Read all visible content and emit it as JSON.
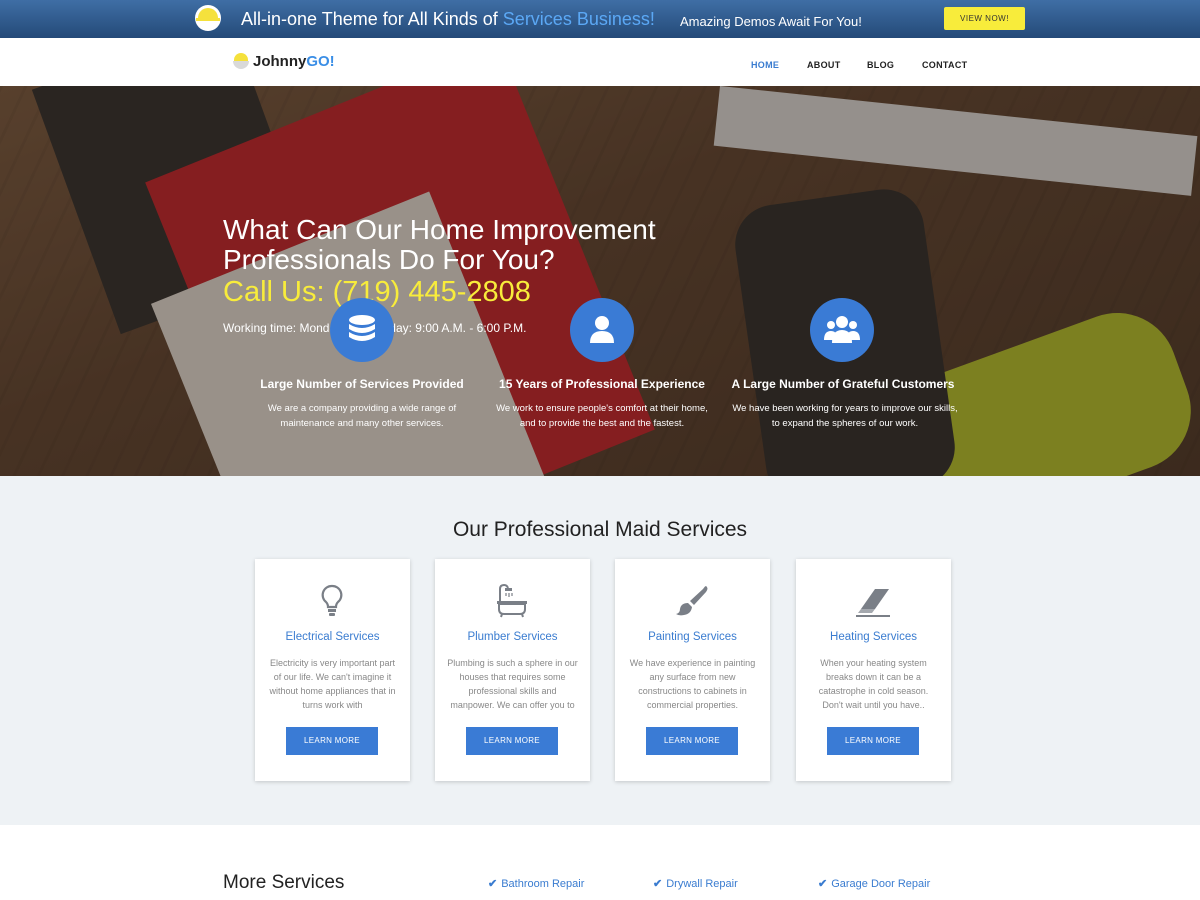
{
  "promo": {
    "title_prefix": "All-in-one Theme for All Kinds of ",
    "title_highlight": "Services Business!",
    "subtitle": "Amazing Demos Await For You!",
    "button": "VIEW NOW!"
  },
  "header": {
    "brand_name": "Johnny",
    "brand_suffix": "GO!",
    "nav": [
      "HOME",
      "ABOUT",
      "BLOG",
      "CONTACT"
    ],
    "active_nav": "HOME"
  },
  "hero": {
    "title": "What Can Our Home Improvement Professionals Do For You?",
    "call": "Call Us: (719) 445-2808",
    "hours": "Working time: Monday to Thursday: 9:00 A.M. - 6:00 P.M.",
    "features": [
      {
        "icon": "database-icon",
        "title": "Large Number of Services Provided",
        "text": "We are a company providing a wide range of maintenance and many other services."
      },
      {
        "icon": "user-icon",
        "title": "15 Years of Professional Experience",
        "text": "We work to ensure people's comfort at their home, and to provide the best and the fastest."
      },
      {
        "icon": "users-icon",
        "title": "A Large Number of Grateful Customers",
        "text": "We have been working for years to improve our skills, to expand the spheres of our work."
      }
    ]
  },
  "services": {
    "title": "Our Professional Maid Services",
    "cards": [
      {
        "icon": "lightbulb-icon",
        "title": "Electrical Services",
        "text": "Electricity is very important part of our life. We can't imagine it without home appliances that in turns work with",
        "button": "LEARN MORE"
      },
      {
        "icon": "bathtub-icon",
        "title": "Plumber Services",
        "text": "Plumbing is such a sphere in our houses that requires some professional skills and manpower. We can offer you to",
        "button": "LEARN MORE"
      },
      {
        "icon": "paintbrush-icon",
        "title": "Painting Services",
        "text": "We have experience in painting any surface from new constructions to cabinets in commercial properties.",
        "button": "LEARN MORE"
      },
      {
        "icon": "eraser-icon",
        "title": "Heating Services",
        "text": "When your heating system breaks down it can be a catastrophe in cold season. Don't wait until you have..",
        "button": "LEARN MORE"
      }
    ]
  },
  "more": {
    "title": "More Services",
    "links": [
      "Bathroom Repair",
      "Drywall Repair",
      "Garage Door Repair"
    ]
  },
  "colors": {
    "accent": "#3a7bd5",
    "highlight_yellow": "#f8ec3b",
    "promo_bg": "#2f5a8c"
  }
}
